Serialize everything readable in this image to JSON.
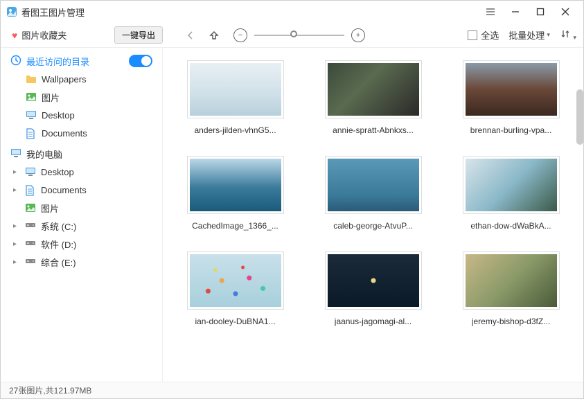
{
  "window": {
    "title": "看图王图片管理"
  },
  "toolbar": {
    "favorites_label": "图片收藏夹",
    "export_label": "一键导出",
    "select_all_label": "全选",
    "batch_label": "批量处理"
  },
  "sidebar": {
    "recent_header": "最近访问的目录",
    "recent_items": [
      {
        "label": "Wallpapers",
        "icon": "folder"
      },
      {
        "label": "图片",
        "icon": "picture"
      },
      {
        "label": "Desktop",
        "icon": "desktop"
      },
      {
        "label": "Documents",
        "icon": "document"
      }
    ],
    "mypc_header": "我的电脑",
    "mypc_items": [
      {
        "label": "Desktop",
        "icon": "desktop",
        "expandable": true
      },
      {
        "label": "Documents",
        "icon": "document",
        "expandable": true
      },
      {
        "label": "图片",
        "icon": "picture",
        "expandable": false
      },
      {
        "label": "系统 (C:)",
        "icon": "drive",
        "expandable": true
      },
      {
        "label": "软件 (D:)",
        "icon": "drive",
        "expandable": true
      },
      {
        "label": "综合 (E:)",
        "icon": "drive",
        "expandable": true
      }
    ]
  },
  "grid_items": [
    {
      "label": "anders-jilden-vhnG5...",
      "bg": "linear-gradient(180deg,#e8f0f4 0%,#cfe0e8 60%,#b8d0dc 100%)"
    },
    {
      "label": "annie-spratt-Abnkxs...",
      "bg": "linear-gradient(135deg,#3a4a3a 0%,#5a6a50 40%,#2a2a28 100%)"
    },
    {
      "label": "brennan-burling-vpa...",
      "bg": "linear-gradient(180deg,#8a9aa8 0%,#6a4838 50%,#3a2820 100%)"
    },
    {
      "label": "CachedImage_1366_...",
      "bg": "linear-gradient(180deg,#bbd8e8 0%,#3a7a9a 55%,#1a5a7a 100%)"
    },
    {
      "label": "caleb-george-AtvuP...",
      "bg": "linear-gradient(180deg,#5a9ab8 0%,#3a7a98 70%,#2a5a78 100%)"
    },
    {
      "label": "ethan-dow-dWaBkA...",
      "bg": "linear-gradient(135deg,#d8e4ea 0%,#8ab8c8 50%,#3a5a48 100%)"
    },
    {
      "label": "ian-dooley-DuBNA1...",
      "bg": "linear-gradient(180deg,#c8e0ea 0%,#a8d0dc 100%)"
    },
    {
      "label": "jaanus-jagomagi-al...",
      "bg": "linear-gradient(180deg,#1a2a38 0%,#0a1a28 100%)"
    },
    {
      "label": "jeremy-bishop-d3fZ...",
      "bg": "linear-gradient(135deg,#c8b888 0%,#8a9a68 50%,#4a5a38 100%)"
    }
  ],
  "statusbar": {
    "text": "27张图片,共121.97MB"
  }
}
